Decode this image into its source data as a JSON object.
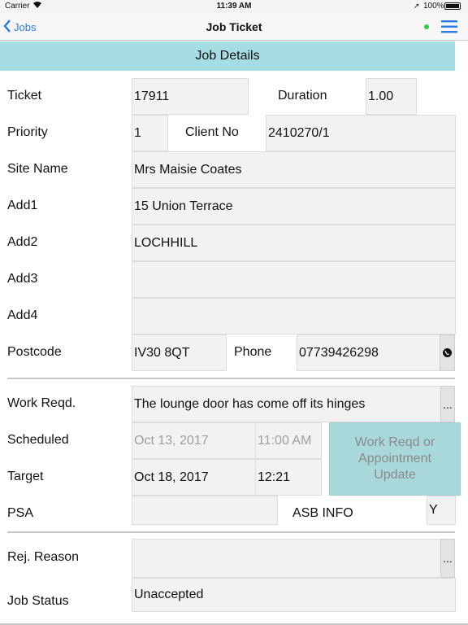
{
  "status_bar": {
    "carrier": "Carrier",
    "time": "11:39 AM",
    "battery": "100%"
  },
  "nav": {
    "back_label": "Jobs",
    "title": "Job Ticket",
    "menu_icon": "hamburger-menu-icon",
    "indicator_color": "#2ecc40"
  },
  "section_title": "Job Details",
  "labels": {
    "ticket": "Ticket",
    "duration": "Duration",
    "priority": "Priority",
    "client_no": "Client No",
    "site_name": "Site Name",
    "add1": "Add1",
    "add2": "Add2",
    "add3": "Add3",
    "add4": "Add4",
    "postcode": "Postcode",
    "phone": "Phone",
    "work_reqd": "Work Reqd.",
    "scheduled": "Scheduled",
    "target": "Target",
    "psa": "PSA",
    "asb_info": "ASB INFO",
    "rej_reason": "Rej. Reason",
    "job_status": "Job Status"
  },
  "values": {
    "ticket": "17911",
    "duration": "1.00",
    "priority": "1",
    "client_no": "2410270/1",
    "site_name": "Mrs Maisie Coates",
    "add1": "15 Union Terrace",
    "add2": "LOCHHILL",
    "add3": "",
    "add4": "",
    "postcode": "IV30 8QT",
    "phone": "07739426298",
    "work_reqd": "The lounge door has come off its hinges",
    "scheduled_date": "Oct 13, 2017",
    "scheduled_time": "11:00 AM",
    "target_date": "Oct 18, 2017",
    "target_time": "12:21",
    "psa": "",
    "asb_info": "Y",
    "rej_reason": "",
    "job_status": "Unaccepted"
  },
  "buttons": {
    "ellipsis": "...",
    "update": "Work Reqd or Appointment Update"
  },
  "colors": {
    "accent": "#2a7ae2",
    "section_bg": "#a6dde3",
    "update_bg": "#a9d8db"
  }
}
